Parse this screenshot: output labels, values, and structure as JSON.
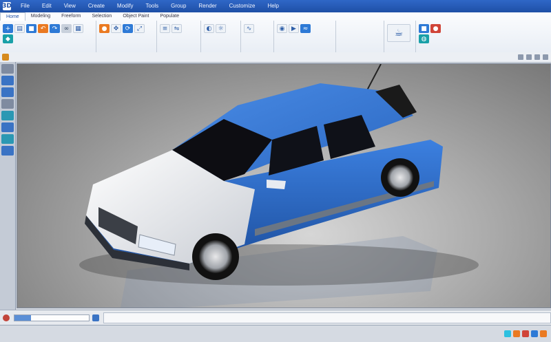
{
  "app": {
    "logo": "3D"
  },
  "menu": [
    "File",
    "Edit",
    "View",
    "Create",
    "Modify",
    "Tools",
    "Group",
    "Render",
    "Customize",
    "Help"
  ],
  "ribbon": {
    "tabs": [
      "Home",
      "Modeling",
      "Freeform",
      "Selection",
      "Object Paint",
      "Populate"
    ],
    "groups": [
      {
        "label": "",
        "icons": [
          "new-icon",
          "open-icon",
          "save-icon",
          "undo-icon",
          "redo-icon",
          "link-icon"
        ]
      },
      {
        "label": "",
        "icons": [
          "select-icon",
          "move-icon",
          "rotate-icon",
          "scale-icon"
        ]
      },
      {
        "label": "",
        "icons": [
          "layer-icon",
          "snap-icon",
          "mirror-icon"
        ]
      },
      {
        "label": "",
        "icons": [
          "material-icon",
          "light-icon"
        ]
      },
      {
        "label": "",
        "icons": [
          "curve-icon",
          "wave-icon"
        ]
      },
      {
        "label": "",
        "icons": [
          "camera-icon",
          "animate-icon"
        ]
      },
      {
        "label": "",
        "icons": [
          "render-icon"
        ]
      },
      {
        "label": "",
        "icons": [
          "shade-icon",
          "paint-icon",
          "globe-icon"
        ]
      }
    ]
  },
  "colors": {
    "car_body": "#2f6fcf",
    "car_body_dark": "#1d4f9e",
    "car_hood": "#f1f3f6",
    "accent": "#1e4fa6"
  },
  "timeline": {
    "progress": 0.22
  },
  "status": {
    "text": ""
  }
}
